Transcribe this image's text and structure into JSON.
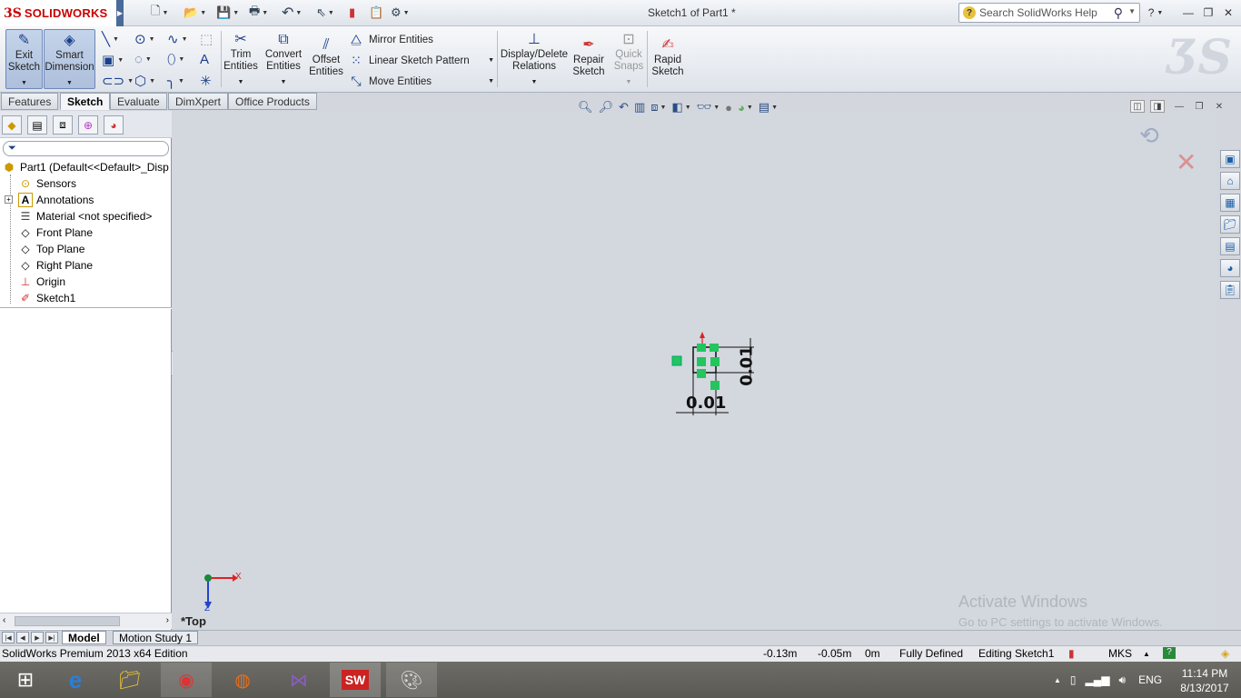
{
  "app": {
    "brand_ds": "3S",
    "brand_name": "SOLIDWORKS",
    "doc_title": "Sketch1 of Part1 *"
  },
  "search": {
    "placeholder": "Search SolidWorks Help"
  },
  "commands": {
    "exit_sketch": [
      "Exit",
      "Sketch"
    ],
    "smart_dimension": [
      "Smart",
      "Dimension"
    ],
    "trim_entities": [
      "Trim",
      "Entities"
    ],
    "convert_entities": [
      "Convert",
      "Entities"
    ],
    "offset_entities": [
      "Offset",
      "Entities"
    ],
    "mirror_entities": "Mirror Entities",
    "linear_sketch_pattern": "Linear Sketch Pattern",
    "move_entities": "Move Entities",
    "display_delete_relations": [
      "Display/Delete",
      "Relations"
    ],
    "repair_sketch": [
      "Repair",
      "Sketch"
    ],
    "quick_snaps": [
      "Quick",
      "Snaps"
    ],
    "rapid_sketch": [
      "Rapid",
      "Sketch"
    ]
  },
  "tabs": [
    "Features",
    "Sketch",
    "Evaluate",
    "DimXpert",
    "Office Products"
  ],
  "active_tab": "Sketch",
  "tree": {
    "root": "Part1  (Default<<Default>_Disp",
    "items": [
      "Sensors",
      "Annotations",
      "Material <not specified>",
      "Front Plane",
      "Top Plane",
      "Right Plane",
      "Origin",
      "Sketch1"
    ]
  },
  "viewport": {
    "dim_horizontal": "0.01",
    "dim_vertical": "0.01",
    "view_name": "*Top",
    "triad_x": "X",
    "triad_z": "Z"
  },
  "watermark": {
    "line1": "Activate Windows",
    "line2": "Go to PC settings to activate Windows."
  },
  "model_tabs": [
    "Model",
    "Motion Study 1"
  ],
  "status": {
    "edition": "SolidWorks Premium 2013 x64 Edition",
    "x": "-0.13m",
    "y": "-0.05m",
    "z": "0m",
    "state": "Fully Defined",
    "editing": "Editing Sketch1",
    "units": "MKS"
  },
  "taskbar": {
    "lang": "ENG",
    "time": "11:14 PM",
    "date": "8/13/2017"
  },
  "colors": {
    "accent": "#1b3f8a",
    "brand": "#cc0000",
    "sketch_green": "#22c55e",
    "viewport_bg": "#d3d7de"
  }
}
